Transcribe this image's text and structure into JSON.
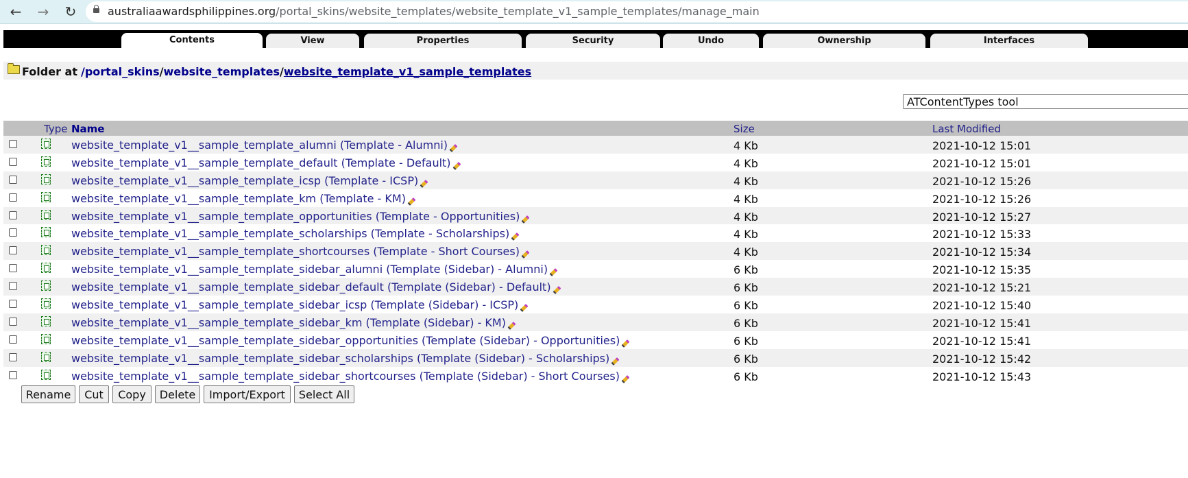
{
  "browser": {
    "url_domain": "australiaawardsphilippines.org",
    "url_path": "/portal_skins/website_templates/website_template_v1_sample_templates/manage_main"
  },
  "tabs": [
    "Contents",
    "View",
    "Properties",
    "Security",
    "Undo",
    "Ownership",
    "Interfaces"
  ],
  "folder": {
    "label": "Folder at",
    "crumbs": [
      "/portal_skins",
      "/",
      "website_templates",
      "/",
      "website_template_v1_sample_templates"
    ]
  },
  "add_select": {
    "value": "ATContentTypes tool"
  },
  "table": {
    "headers": {
      "type": "Type",
      "name": "Name",
      "size": "Size",
      "modified": "Last Modified"
    },
    "rows": [
      {
        "name": "website_template_v1__sample_template_alumni (Template - Alumni)",
        "size": "4 Kb",
        "modified": "2021-10-12 15:01"
      },
      {
        "name": "website_template_v1__sample_template_default (Template - Default)",
        "size": "4 Kb",
        "modified": "2021-10-12 15:01"
      },
      {
        "name": "website_template_v1__sample_template_icsp (Template - ICSP)",
        "size": "4 Kb",
        "modified": "2021-10-12 15:26"
      },
      {
        "name": "website_template_v1__sample_template_km (Template - KM)",
        "size": "4 Kb",
        "modified": "2021-10-12 15:26"
      },
      {
        "name": "website_template_v1__sample_template_opportunities (Template - Opportunities)",
        "size": "4 Kb",
        "modified": "2021-10-12 15:27"
      },
      {
        "name": "website_template_v1__sample_template_scholarships (Template - Scholarships)",
        "size": "4 Kb",
        "modified": "2021-10-12 15:33"
      },
      {
        "name": "website_template_v1__sample_template_shortcourses (Template - Short Courses)",
        "size": "4 Kb",
        "modified": "2021-10-12 15:34"
      },
      {
        "name": "website_template_v1__sample_template_sidebar_alumni (Template (Sidebar) - Alumni)",
        "size": "6 Kb",
        "modified": "2021-10-12 15:35"
      },
      {
        "name": "website_template_v1__sample_template_sidebar_default (Template (Sidebar) - Default)",
        "size": "6 Kb",
        "modified": "2021-10-12 15:21"
      },
      {
        "name": "website_template_v1__sample_template_sidebar_icsp (Template (Sidebar) - ICSP)",
        "size": "6 Kb",
        "modified": "2021-10-12 15:40"
      },
      {
        "name": "website_template_v1__sample_template_sidebar_km (Template (Sidebar) - KM)",
        "size": "6 Kb",
        "modified": "2021-10-12 15:41"
      },
      {
        "name": "website_template_v1__sample_template_sidebar_opportunities (Template (Sidebar) - Opportunities)",
        "size": "6 Kb",
        "modified": "2021-10-12 15:41"
      },
      {
        "name": "website_template_v1__sample_template_sidebar_scholarships (Template (Sidebar) - Scholarships)",
        "size": "6 Kb",
        "modified": "2021-10-12 15:42"
      },
      {
        "name": "website_template_v1__sample_template_sidebar_shortcourses (Template (Sidebar) - Short Courses)",
        "size": "6 Kb",
        "modified": "2021-10-12 15:43"
      }
    ]
  },
  "buttons": [
    "Rename",
    "Cut",
    "Copy",
    "Delete",
    "Import/Export",
    "Select All"
  ]
}
